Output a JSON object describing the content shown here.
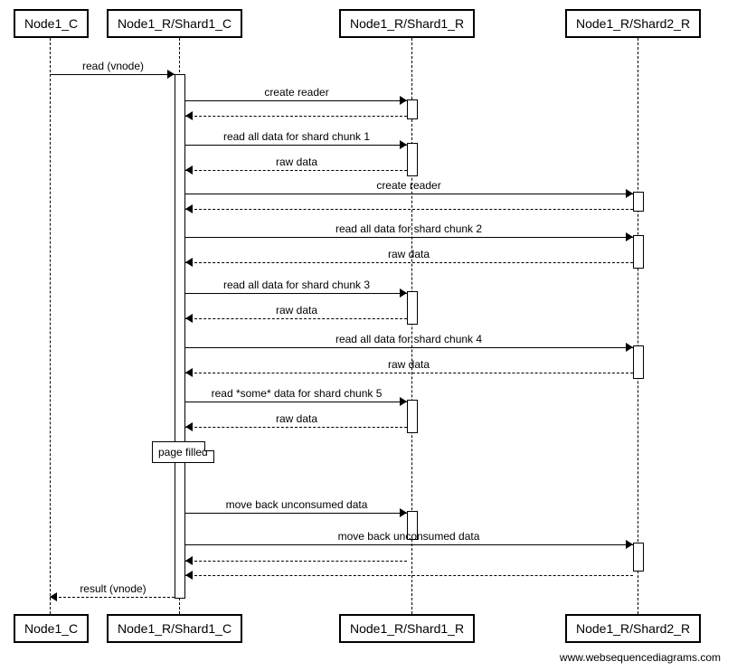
{
  "participants": {
    "p1": "Node1_C",
    "p2": "Node1_R/Shard1_C",
    "p3": "Node1_R/Shard1_R",
    "p4": "Node1_R/Shard2_R"
  },
  "messages": {
    "m1": "read (vnode)",
    "m2": "create reader",
    "m3": "read all data for shard chunk 1",
    "m4": "raw data",
    "m5": "create reader",
    "m6": "read all data for shard chunk 2",
    "m7": "raw data",
    "m8": "read all data for shard chunk 3",
    "m9": "raw data",
    "m10": "read all data for shard chunk 4",
    "m11": "raw data",
    "m12": "read *some* data for shard chunk 5",
    "m13": "raw data",
    "m14": "move back unconsumed data",
    "m15": "move back unconsumed data",
    "m16": "result (vnode)"
  },
  "note": "page filled",
  "credit": "www.websequencediagrams.com"
}
